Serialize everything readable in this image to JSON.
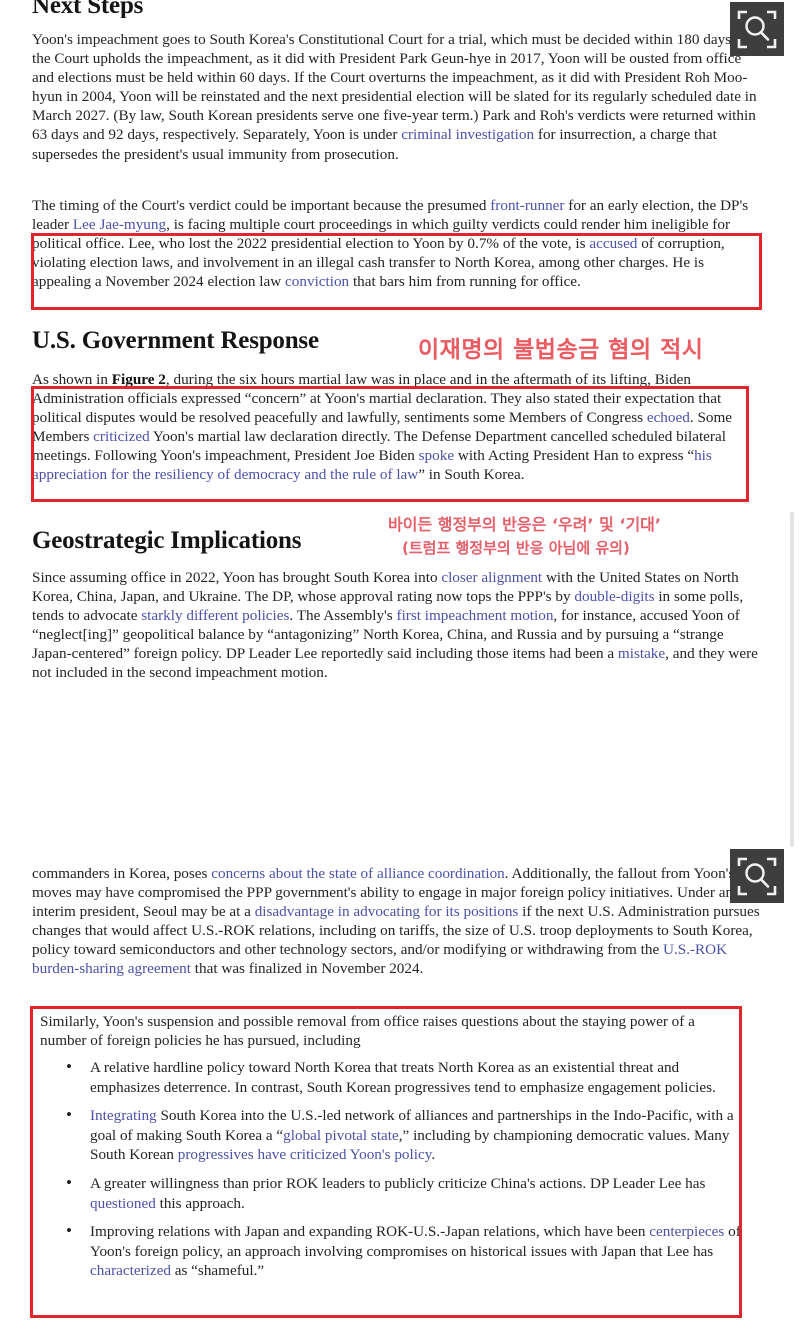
{
  "viewer": {
    "magnifier_icon_label": "magnify-overlay",
    "scrollbar_label": "vertical-scrollbar"
  },
  "document": {
    "sections": [
      {
        "heading": "Next Steps",
        "paragraphs": [
          {
            "id": "p1",
            "runs": [
              {
                "t": "Yoon's impeachment goes to South Korea's Constitutional Court for a trial, which must be decided within 180 days. If the Court upholds the impeachment, as it did with President Park Geun-hye in 2017, Yoon will be ousted from office and elections must be held within 60 days. If the Court overturns the impeachment, as it did with President Roh Moo-hyun in 2004, Yoon will be reinstated and the next presidential election will be slated for its regularly scheduled date in March 2027. (By law, South Korean presidents serve one five-year term.) Park and Roh's verdicts were returned within 63 days and 92 days, respectively. Separately, Yoon is under ",
                "k": "plain"
              },
              {
                "t": "criminal investigation",
                "k": "link"
              },
              {
                "t": " for insurrection, a charge that supersedes the president's usual immunity from prosecution.",
                "k": "plain"
              }
            ]
          },
          {
            "id": "p2",
            "runs": [
              {
                "t": "The timing of the Court's verdict could be important because the presumed ",
                "k": "plain"
              },
              {
                "t": "front-runner",
                "k": "link"
              },
              {
                "t": " for an early election, the DP's leader ",
                "k": "plain"
              },
              {
                "t": "Lee Jae-myung",
                "k": "link"
              },
              {
                "t": ", is facing multiple court proceedings in which guilty verdicts could render him ineligible for political office. Lee, who lost the 2022 presidential election to Yoon by 0.7% of the vote, is ",
                "k": "plain"
              },
              {
                "t": "accused",
                "k": "link"
              },
              {
                "t": " of corruption, violating election laws, and involvement in an illegal cash transfer to North Korea, among other charges. He is appealing a November 2024 election law ",
                "k": "plain"
              },
              {
                "t": "conviction",
                "k": "link"
              },
              {
                "t": " that bars him from running for office.",
                "k": "plain"
              }
            ]
          }
        ]
      },
      {
        "heading": "U.S. Government Response",
        "paragraphs": [
          {
            "id": "p3",
            "runs": [
              {
                "t": "As shown in ",
                "k": "plain"
              },
              {
                "t": "Figure 2",
                "k": "bold"
              },
              {
                "t": ", during the six hours martial law was in place and in the aftermath of its lifting, Biden Administration officials expressed “concern” at Yoon's martial declaration. They also stated their expectation that political disputes would be resolved peacefully and lawfully, sentiments some Members of Congress ",
                "k": "plain"
              },
              {
                "t": "echoed",
                "k": "link"
              },
              {
                "t": ". Some Members ",
                "k": "plain"
              },
              {
                "t": "criticized",
                "k": "link"
              },
              {
                "t": " Yoon's martial law declaration directly. The Defense Department cancelled scheduled bilateral meetings. Following Yoon's impeachment, President Joe Biden ",
                "k": "plain"
              },
              {
                "t": "spoke",
                "k": "link"
              },
              {
                "t": " with Acting President Han to express “",
                "k": "plain"
              },
              {
                "t": "his appreciation for the resiliency of democracy and the rule of law",
                "k": "link"
              },
              {
                "t": "” in South Korea.",
                "k": "plain"
              }
            ]
          }
        ]
      },
      {
        "heading": "Geostrategic Implications",
        "paragraphs": [
          {
            "id": "p4",
            "runs": [
              {
                "t": "Since assuming office in 2022, Yoon has brought South Korea into ",
                "k": "plain"
              },
              {
                "t": "closer alignment",
                "k": "link"
              },
              {
                "t": " with the United States on North Korea, China, Japan, and Ukraine. The DP, whose approval rating now tops the PPP's by ",
                "k": "plain"
              },
              {
                "t": "double-digits",
                "k": "link"
              },
              {
                "t": " in some polls, tends to advocate ",
                "k": "plain"
              },
              {
                "t": "starkly different policies",
                "k": "link"
              },
              {
                "t": ". The Assembly's ",
                "k": "plain"
              },
              {
                "t": "first impeachment motion",
                "k": "link"
              },
              {
                "t": ", for instance, accused Yoon of “neglect[ing]” geopolitical balance by “antagonizing” North Korea, China, and Russia and by pursuing a “strange Japan-centered” foreign policy. DP Leader Lee reportedly said including those items had been a ",
                "k": "plain"
              },
              {
                "t": "mistake",
                "k": "link"
              },
              {
                "t": ", and they were not included in the second impeachment motion.",
                "k": "plain"
              }
            ]
          },
          {
            "id": "p5",
            "runs": [
              {
                "t": " commanders in Korea, poses ",
                "k": "plain"
              },
              {
                "t": "concerns about the state of alliance coordination",
                "k": "link"
              },
              {
                "t": ". Additionally, the fallout from Yoon's moves may have compromised the PPP government's ability to engage in major foreign policy initiatives. Under an interim president, Seoul may be at a ",
                "k": "plain"
              },
              {
                "t": "disadvantage in advocating for its positions",
                "k": "link"
              },
              {
                "t": " if the next U.S. Administration pursues changes that would affect U.S.-ROK relations, including on tariffs, the size of U.S. troop deployments to South Korea, policy toward semiconductors and other technology sectors, and/or modifying or withdrawing from the ",
                "k": "plain"
              },
              {
                "t": "U.S.-ROK burden-sharing agreement",
                "k": "link"
              },
              {
                "t": " that was finalized in November 2024.",
                "k": "plain"
              }
            ]
          },
          {
            "id": "p6",
            "runs": [
              {
                "t": "Similarly, Yoon's suspension and possible removal from office raises questions about the staying power of a number of foreign policies he has pursued, including",
                "k": "plain"
              }
            ]
          }
        ],
        "bullets": [
          {
            "id": "b1",
            "runs": [
              {
                "t": "A relative hardline policy toward North Korea that treats North Korea as an existential threat and emphasizes deterrence. In contrast, South Korean progressives tend to emphasize engagement policies.",
                "k": "plain"
              }
            ]
          },
          {
            "id": "b2",
            "runs": [
              {
                "t": "Integrating",
                "k": "link"
              },
              {
                "t": " South Korea into the U.S.-led network of alliances and partnerships in the Indo-Pacific, with a goal of making South Korea a “",
                "k": "plain"
              },
              {
                "t": "global pivotal state",
                "k": "link"
              },
              {
                "t": ",” including by championing democratic values. Many South Korean ",
                "k": "plain"
              },
              {
                "t": "progressives have criticized Yoon's policy",
                "k": "link"
              },
              {
                "t": ".",
                "k": "plain"
              }
            ]
          },
          {
            "id": "b3",
            "runs": [
              {
                "t": "A greater willingness than prior ROK leaders to publicly criticize China's actions. DP Leader Lee has ",
                "k": "plain"
              },
              {
                "t": "questioned",
                "k": "link"
              },
              {
                "t": " this approach.",
                "k": "plain"
              }
            ]
          },
          {
            "id": "b4",
            "runs": [
              {
                "t": "Improving relations with Japan and expanding ROK-U.S.-Japan relations, which have been ",
                "k": "plain"
              },
              {
                "t": "centerpieces",
                "k": "link"
              },
              {
                "t": " of Yoon's foreign policy, an approach involving compromises on historical issues with Japan that Lee has ",
                "k": "plain"
              },
              {
                "t": "characterized",
                "k": "link"
              },
              {
                "t": " as “shameful.”",
                "k": "plain"
              }
            ]
          }
        ]
      }
    ]
  },
  "annotations": {
    "korean_1": "이재명의 불법송금 혐의 적시",
    "korean_2": "바이든 행정부의 반응은 ‘우려’ 및 ‘기대’",
    "korean_3": "(트럼프 행정부의 반응 아님에 유의)"
  },
  "colors": {
    "redbox": "#e0262c",
    "korean_accent": "#e8545c",
    "link": "#4a52a8",
    "overlay_bg": "#3e3e3e"
  }
}
